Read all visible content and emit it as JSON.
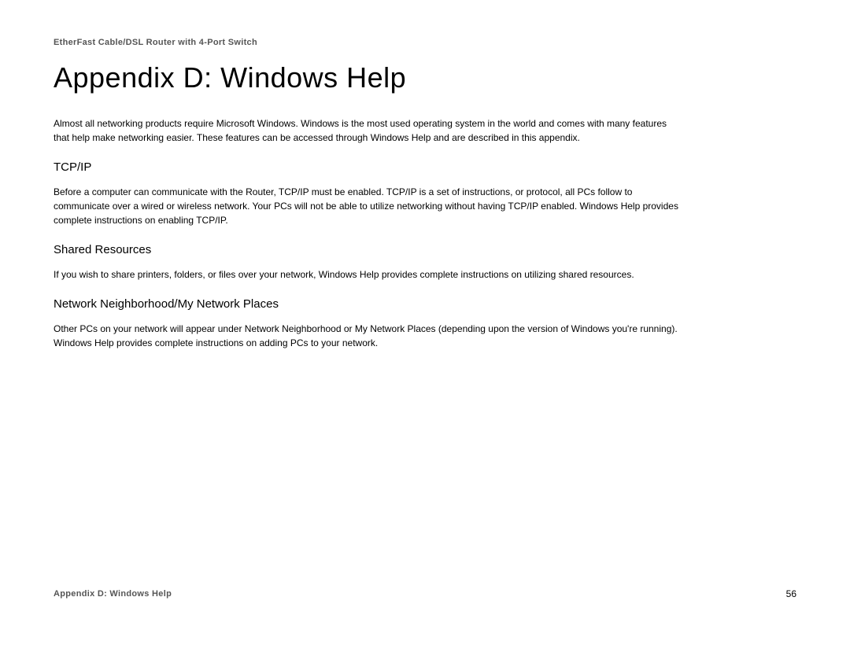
{
  "header": {
    "product_name": "EtherFast Cable/DSL Router with 4-Port Switch"
  },
  "title": "Appendix D: Windows Help",
  "intro_paragraph": "Almost all networking products require Microsoft Windows. Windows is the most used operating system in the world and comes with many features that help make networking easier. These features can be accessed through Windows Help and are described in this appendix.",
  "sections": [
    {
      "heading": "TCP/IP",
      "body": "Before a computer can communicate with the Router, TCP/IP must be enabled. TCP/IP is a set of instructions, or protocol, all PCs follow to communicate over a wired or wireless network. Your PCs will not be able to utilize networking without having TCP/IP enabled. Windows Help provides complete instructions on enabling TCP/IP."
    },
    {
      "heading": "Shared Resources",
      "body": "If you wish to share printers, folders, or files over your network, Windows Help provides complete instructions on utilizing shared resources."
    },
    {
      "heading": "Network Neighborhood/My Network Places",
      "body": "Other PCs on your network will appear under Network Neighborhood or My Network Places (depending upon the version of Windows you're running). Windows Help provides complete instructions on adding PCs to your network."
    }
  ],
  "footer": {
    "label": "Appendix D: Windows Help",
    "page_number": "56"
  }
}
